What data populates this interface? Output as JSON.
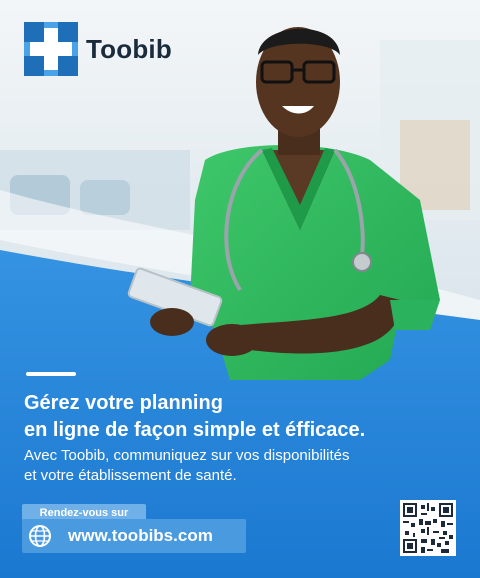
{
  "brand": {
    "name": "Toobib",
    "accent_color": "#1f7fd6",
    "logo_icon": "medical-cross-logo-icon"
  },
  "headline": {
    "line1": "Gérez votre planning",
    "line2": "en ligne de façon simple et éfficace."
  },
  "subtext": {
    "line1": "Avec Toobib, communiquez sur vos disponibilités",
    "line2": "et votre établissement de santé."
  },
  "cta": {
    "label": "Rendez-vous sur",
    "url": "www.toobibs.com",
    "icon": "globe-icon"
  },
  "qr_code": {
    "icon": "qr-code-icon"
  }
}
